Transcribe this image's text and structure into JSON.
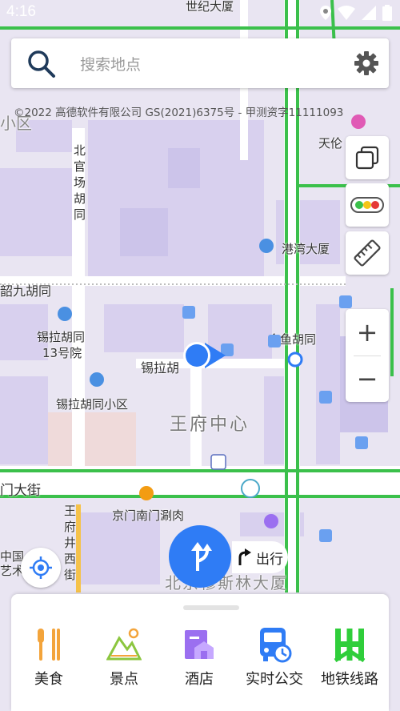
{
  "status_bar": {
    "time": "4:16"
  },
  "search": {
    "placeholder": "搜索地点"
  },
  "copyright": "©2022 高德软件有限公司 GS(2021)6375号 - 甲测资字11111093",
  "map_labels": {
    "century_building": "世纪大厦",
    "beiguan_1": "北",
    "beiguan_2": "官",
    "beiguan_3": "场",
    "beiguan_4": "胡",
    "beiguan_5": "同",
    "shaojiu": "韶九胡同",
    "tianlun": "天伦",
    "gangwan": "港湾大厦",
    "xila_13_a": "锡拉胡同",
    "xila_13_b": "13号院",
    "jinyu": "金鱼胡同",
    "xila_road": "锡拉胡",
    "xila_xiaoqu": "锡拉胡同小区",
    "wangfu_center": "王府中心",
    "avenue": "门大街",
    "jingmen_hotpot": "京门南门涮肉",
    "wangfujing_1": "王",
    "wangfujing_2": "府",
    "wangfujing_3": "井",
    "wangfujing_4": "西",
    "wangfujing_5": "街",
    "muslim_building": "北京穆斯林大厦",
    "china_art_1": "中国",
    "china_art_2": "艺术",
    "district_1": "小区",
    "nan_1": "南"
  },
  "controls": {
    "zoom_in": "+",
    "zoom_out": "−",
    "layers_icon": "layers-icon",
    "traffic_icon": "traffic-light-icon",
    "ruler_icon": "ruler-icon"
  },
  "travel": {
    "label": "出行"
  },
  "categories": [
    {
      "label": "美食",
      "icon": "food-icon",
      "color": "#f3a43b"
    },
    {
      "label": "景点",
      "icon": "scenic-icon",
      "color": "#8cc63f"
    },
    {
      "label": "酒店",
      "icon": "hotel-icon",
      "color": "#9b6ff0"
    },
    {
      "label": "实时公交",
      "icon": "bus-icon",
      "color": "#2f7cf5"
    },
    {
      "label": "地铁线路",
      "icon": "subway-icon",
      "color": "#2fce3a"
    }
  ],
  "colors": {
    "accent": "#2f7cf5",
    "road_green": "#3bc04b",
    "map_bg": "#e8e4f1"
  }
}
